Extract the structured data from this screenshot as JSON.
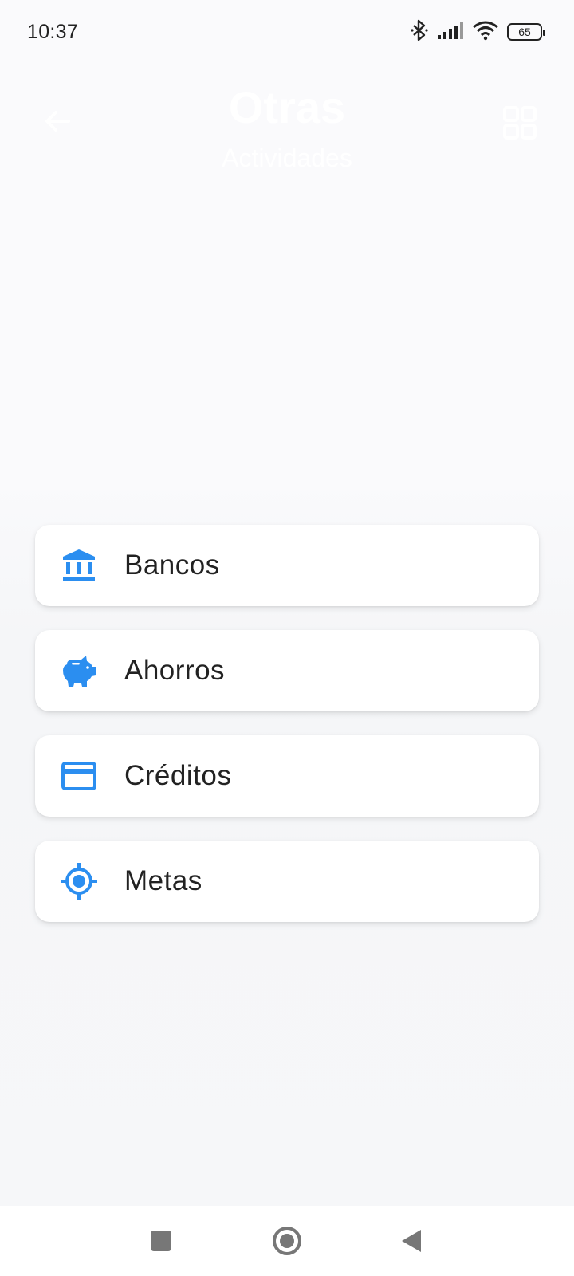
{
  "status_bar": {
    "time": "10:37",
    "battery": "65",
    "icons": [
      "bluetooth-icon",
      "signal-icon",
      "wifi-icon",
      "battery-icon"
    ]
  },
  "header": {
    "title": "Otras",
    "subtitle": "Actividades",
    "back_icon": "back-arrow-icon",
    "grid_icon": "grid-view-icon"
  },
  "menu": {
    "items": [
      {
        "label": "Bancos",
        "icon": "bank-icon"
      },
      {
        "label": "Ahorros",
        "icon": "piggy-bank-icon"
      },
      {
        "label": "Créditos",
        "icon": "credit-card-icon"
      },
      {
        "label": "Metas",
        "icon": "target-icon"
      }
    ]
  },
  "nav_bar": {
    "icons": [
      "recents-icon",
      "home-icon",
      "back-icon"
    ]
  },
  "colors": {
    "accent": "#2b8ef0",
    "text": "#222222",
    "card": "#ffffff"
  }
}
